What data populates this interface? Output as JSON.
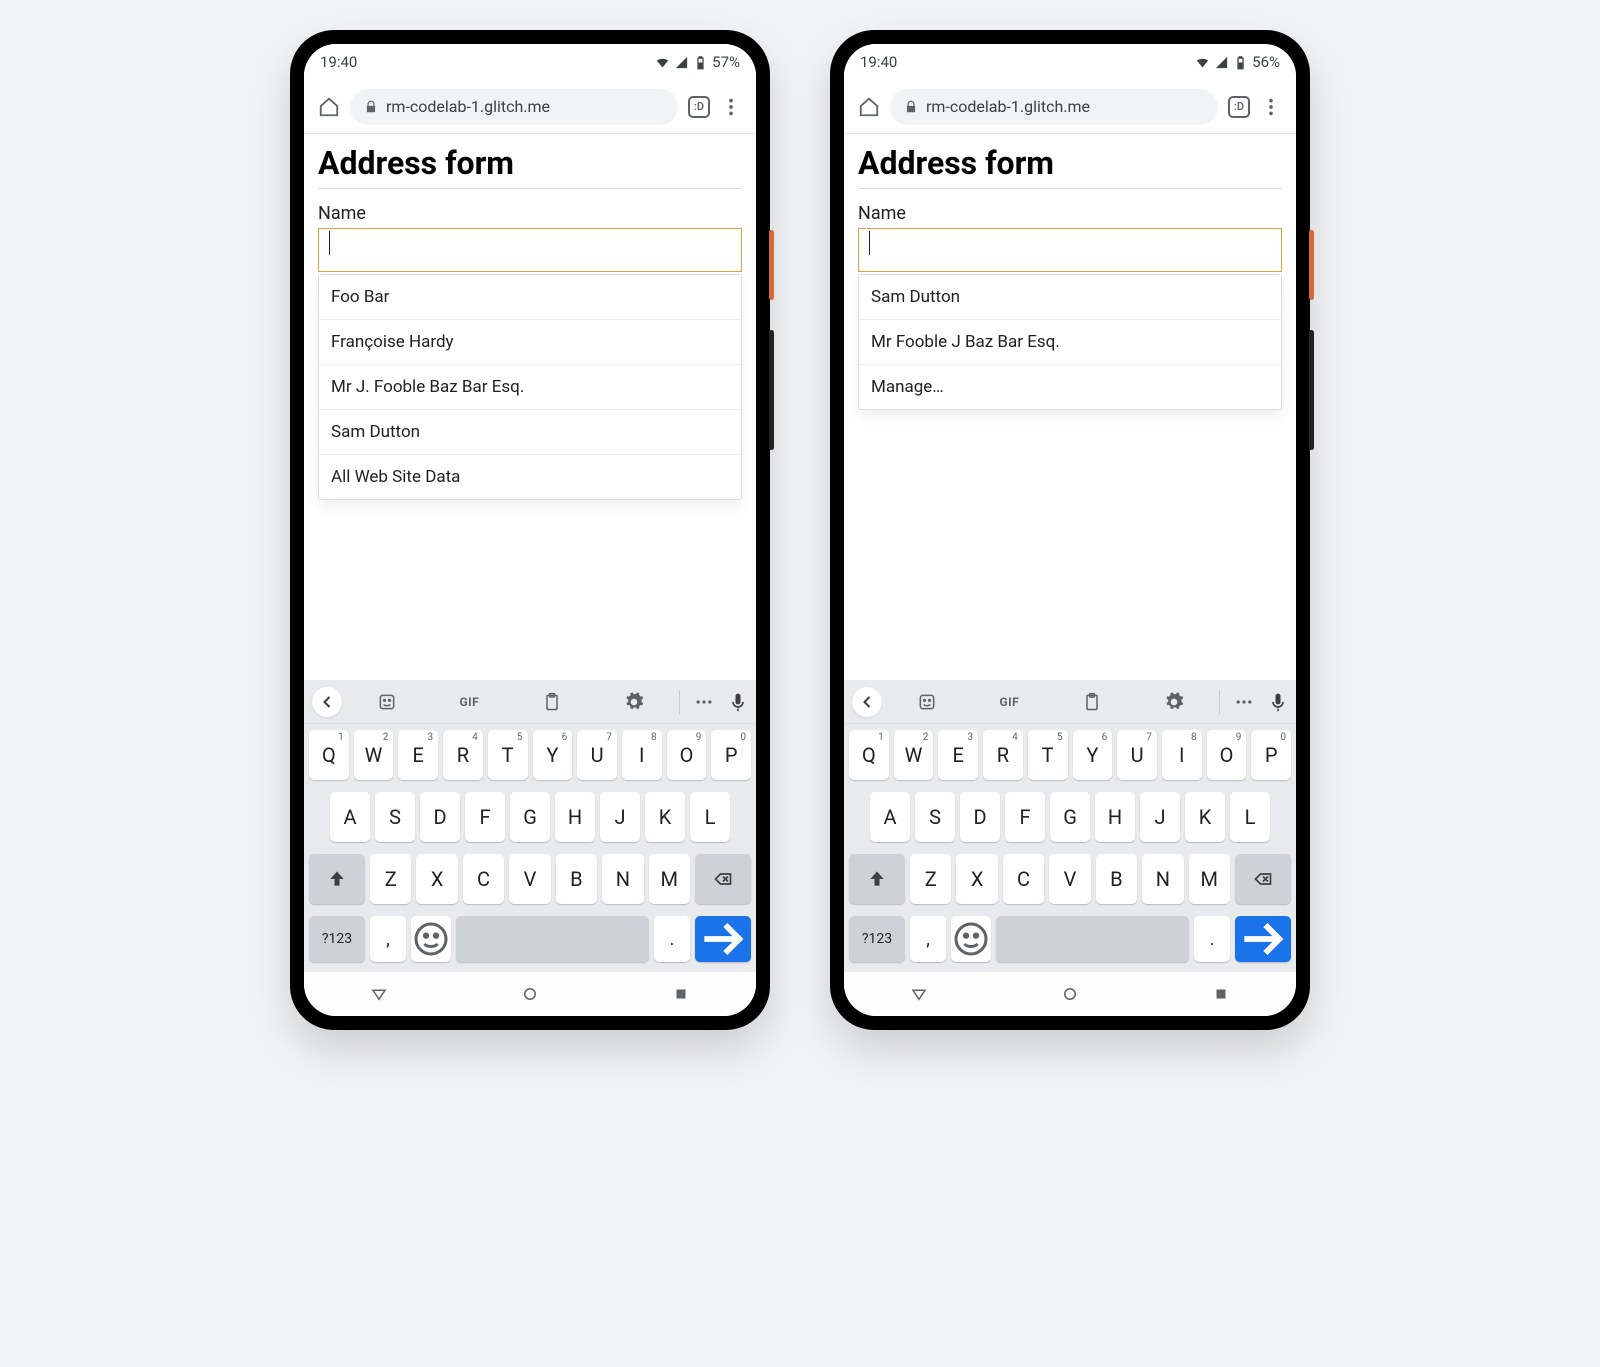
{
  "phones": [
    {
      "status": {
        "time": "19:40",
        "battery": "57%"
      },
      "chrome": {
        "url": "rm-codelab-1.glitch.me",
        "tab_badge": ":D"
      },
      "page": {
        "heading": "Address form",
        "label": "Name",
        "input_value": "",
        "suggestions": [
          "Foo Bar",
          "Françoise Hardy",
          "Mr J. Fooble Baz Bar Esq.",
          "Sam Dutton",
          "All Web Site Data"
        ]
      }
    },
    {
      "status": {
        "time": "19:40",
        "battery": "56%"
      },
      "chrome": {
        "url": "rm-codelab-1.glitch.me",
        "tab_badge": ":D"
      },
      "page": {
        "heading": "Address form",
        "label": "Name",
        "input_value": "",
        "suggestions": [
          "Sam Dutton",
          "Mr Fooble J Baz Bar Esq.",
          "Manage…"
        ]
      }
    }
  ],
  "keyboard": {
    "gif_label": "GIF",
    "row1": [
      {
        "k": "Q",
        "n": "1"
      },
      {
        "k": "W",
        "n": "2"
      },
      {
        "k": "E",
        "n": "3"
      },
      {
        "k": "R",
        "n": "4"
      },
      {
        "k": "T",
        "n": "5"
      },
      {
        "k": "Y",
        "n": "6"
      },
      {
        "k": "U",
        "n": "7"
      },
      {
        "k": "I",
        "n": "8"
      },
      {
        "k": "O",
        "n": "9"
      },
      {
        "k": "P",
        "n": "0"
      }
    ],
    "row2": [
      "A",
      "S",
      "D",
      "F",
      "G",
      "H",
      "J",
      "K",
      "L"
    ],
    "row3": [
      "Z",
      "X",
      "C",
      "V",
      "B",
      "N",
      "M"
    ],
    "numkey": "?123",
    "comma": ",",
    "period": "."
  }
}
